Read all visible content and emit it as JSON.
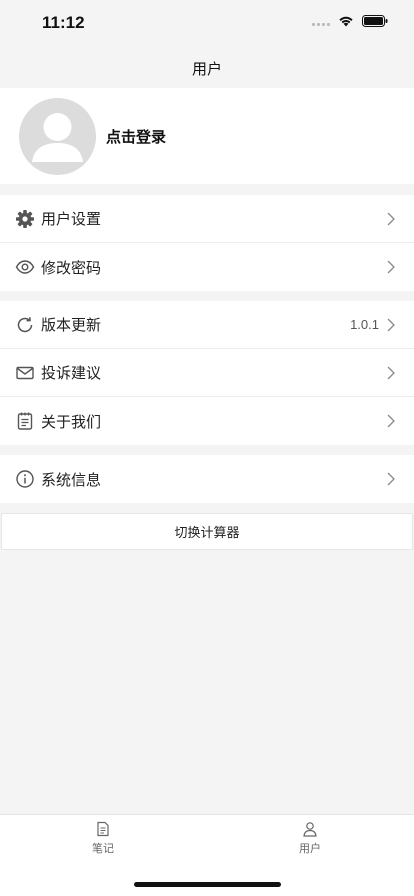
{
  "status_bar": {
    "time": "11:12"
  },
  "nav": {
    "title": "用户"
  },
  "profile": {
    "login_label": "点击登录"
  },
  "menu_group_1": [
    {
      "label": "用户设置",
      "icon": "gear-icon"
    },
    {
      "label": "修改密码",
      "icon": "eye-icon"
    }
  ],
  "menu_group_2": [
    {
      "label": "版本更新",
      "icon": "refresh-icon",
      "value": "1.0.1"
    },
    {
      "label": "投诉建议",
      "icon": "mail-icon"
    },
    {
      "label": "关于我们",
      "icon": "notepad-icon"
    }
  ],
  "menu_group_3": [
    {
      "label": "系统信息",
      "icon": "info-icon"
    }
  ],
  "switch_button": {
    "label": "切换计算器"
  },
  "tab_bar": {
    "tabs": [
      {
        "label": "笔记",
        "icon": "document-icon",
        "active": false
      },
      {
        "label": "用户",
        "icon": "user-icon",
        "active": true
      }
    ]
  },
  "colors": {
    "background": "#f4f4f4",
    "card": "#ffffff",
    "avatar": "#dcdcdc",
    "icon": "#555555"
  }
}
